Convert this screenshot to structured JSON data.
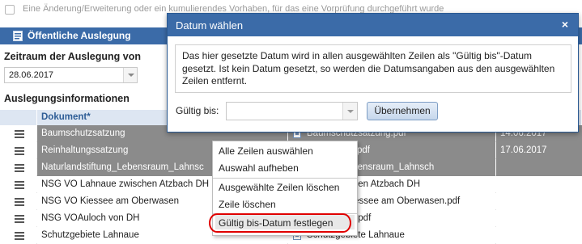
{
  "top_checkbox": {
    "label": "Eine Änderung/Erweiterung oder ein kumulierendes Vorhaben, für das eine Vorprüfung durchgeführt wurde",
    "checked": false
  },
  "section": {
    "title": "Öffentliche Auslegung"
  },
  "period": {
    "label": "Zeitraum der Auslegung von",
    "value": "28.06.2017"
  },
  "info": {
    "label": "Auslegungsinformationen"
  },
  "table": {
    "columns": [
      "Dokument*"
    ],
    "rows": [
      {
        "doc": "Baumschutzsatzung",
        "file": "Baumschutzsatzung.pdf",
        "date": "14.06.2017",
        "selected": true
      },
      {
        "doc": "Reinhaltungssatzung",
        "file": "ngssatzung.pdf",
        "date": "17.06.2017",
        "selected": true
      },
      {
        "doc": "Naturlandstiftung_Lebensraum_Lahnsc",
        "file": "stiftung_Lebensraum_Lahnsch",
        "date": "",
        "selected": true
      },
      {
        "doc": "NSG VO Lahnaue zwischen Atzbach DH",
        "file": "naue zwischen Atzbach DH",
        "date": "",
        "selected": false
      },
      {
        "doc": "NSG VO Kiessee am Oberwasen",
        "file": "NSG VO Kiessee am Oberwasen.pdf",
        "date": "",
        "selected": false
      },
      {
        "doc": "NSG VOAuloch von DH",
        "file": "och von DH.pdf",
        "date": "",
        "selected": false
      },
      {
        "doc": "Schutzgebiete Lahnaue",
        "file": "Schutzgebiete Lahnaue",
        "date": "",
        "selected": false
      }
    ]
  },
  "context_menu": {
    "items": [
      "Alle Zeilen auswählen",
      "Auswahl aufheben",
      "Ausgewählte Zeilen löschen",
      "Zeile löschen",
      "Gültig bis-Datum festlegen"
    ],
    "highlight_color": "#e00000"
  },
  "dialog": {
    "title": "Datum wählen",
    "close": "×",
    "message": "Das hier gesetzte Datum wird in allen ausgewählten Zeilen als \"Gültig bis\"-Datum gesetzt. Ist kein Datum gesetzt, so werden die Datumsangaben aus den ausgewählten Zeilen entfernt.",
    "field_label": "Gültig bis:",
    "field_value": "",
    "button": "Übernehmen"
  },
  "colors": {
    "accent": "#3b6ba8",
    "selected_row": "#8b8b8b",
    "header_bg": "#dde6f2"
  }
}
